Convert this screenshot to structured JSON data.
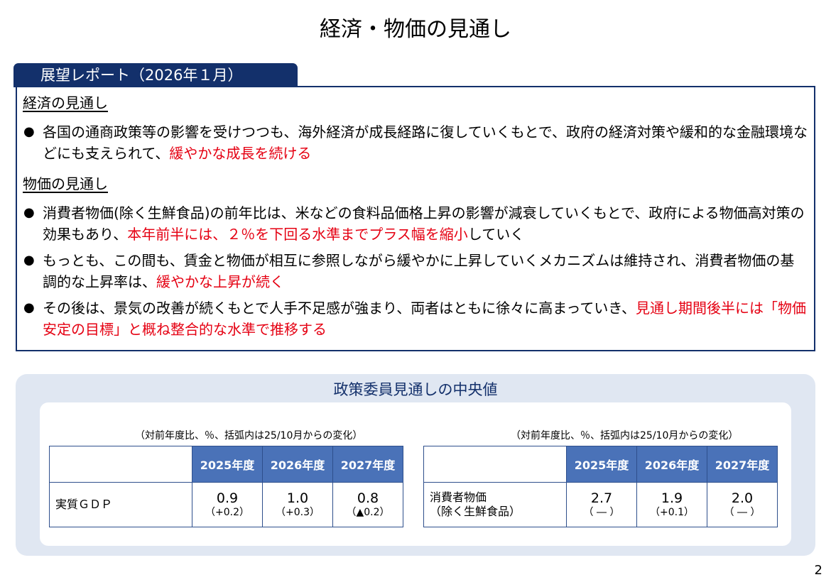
{
  "title": "経済・物価の見通し",
  "tab_label": "展望レポート（2026年１月）",
  "economy": {
    "heading": "経済の見通し",
    "bullets": [
      {
        "text": "各国の通商政策等の影響を受けつつも、海外経済が成長経路に復していくもとで、政府の経済対策や緩和的な金融環境などにも支えられて、",
        "highlight": "緩やかな成長を続ける",
        "tail": ""
      }
    ]
  },
  "prices": {
    "heading": "物価の見通し",
    "bullets": [
      {
        "text": "消費者物価(除く生鮮食品)の前年比は、米などの食料品価格上昇の影響が減衰していくもとで、政府による物価高対策の効果もあり、",
        "highlight": "本年前半には、２％を下回る水準までプラス幅を縮小",
        "tail": "していく"
      },
      {
        "text": "もっとも、この間も、賃金と物価が相互に参照しながら緩やかに上昇していくメカニズムは維持され、消費者物価の基調的な上昇率は、",
        "highlight": "緩やかな上昇が続く",
        "tail": ""
      },
      {
        "text": "その後は、景気の改善が続くもとで人手不足感が強まり、両者はともに徐々に高まっていき、",
        "highlight": "見通し期間後半には「物価安定の目標」と概ね整合的な水準で推移する",
        "tail": ""
      }
    ]
  },
  "forecast_panel": {
    "title": "政策委員見通しの中央値",
    "note": "（対前年度比、％、括弧内は25/10月からの変化）",
    "years": [
      "2025年度",
      "2026年度",
      "2027年度"
    ],
    "gdp": {
      "label": "実質ＧＤＰ",
      "values": [
        "0.9",
        "1.0",
        "0.8"
      ],
      "changes": [
        "（+0.2）",
        "（+0.3）",
        "（▲0.2）"
      ]
    },
    "cpi": {
      "label_line1": "消費者物価",
      "label_line2": "（除く生鮮食品）",
      "values": [
        "2.7",
        "1.9",
        "2.0"
      ],
      "changes": [
        "（ ― ）",
        "（+0.1）",
        "（ ― ）"
      ]
    }
  },
  "page_number": "2",
  "colors": {
    "navy": "#13306b",
    "header_blue": "#4a72b8",
    "panel_bg": "#e0e7f2",
    "highlight_red": "#e50012"
  }
}
